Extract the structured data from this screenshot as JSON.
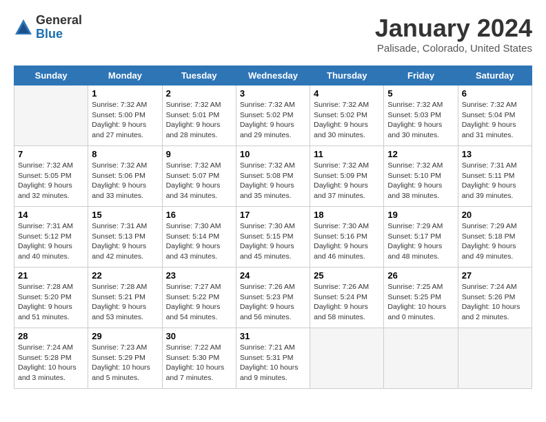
{
  "logo": {
    "general": "General",
    "blue": "Blue"
  },
  "header": {
    "title": "January 2024",
    "subtitle": "Palisade, Colorado, United States"
  },
  "days_of_week": [
    "Sunday",
    "Monday",
    "Tuesday",
    "Wednesday",
    "Thursday",
    "Friday",
    "Saturday"
  ],
  "weeks": [
    [
      {
        "day": "",
        "info": ""
      },
      {
        "day": "1",
        "info": "Sunrise: 7:32 AM\nSunset: 5:00 PM\nDaylight: 9 hours\nand 27 minutes."
      },
      {
        "day": "2",
        "info": "Sunrise: 7:32 AM\nSunset: 5:01 PM\nDaylight: 9 hours\nand 28 minutes."
      },
      {
        "day": "3",
        "info": "Sunrise: 7:32 AM\nSunset: 5:02 PM\nDaylight: 9 hours\nand 29 minutes."
      },
      {
        "day": "4",
        "info": "Sunrise: 7:32 AM\nSunset: 5:02 PM\nDaylight: 9 hours\nand 30 minutes."
      },
      {
        "day": "5",
        "info": "Sunrise: 7:32 AM\nSunset: 5:03 PM\nDaylight: 9 hours\nand 30 minutes."
      },
      {
        "day": "6",
        "info": "Sunrise: 7:32 AM\nSunset: 5:04 PM\nDaylight: 9 hours\nand 31 minutes."
      }
    ],
    [
      {
        "day": "7",
        "info": "Sunrise: 7:32 AM\nSunset: 5:05 PM\nDaylight: 9 hours\nand 32 minutes."
      },
      {
        "day": "8",
        "info": "Sunrise: 7:32 AM\nSunset: 5:06 PM\nDaylight: 9 hours\nand 33 minutes."
      },
      {
        "day": "9",
        "info": "Sunrise: 7:32 AM\nSunset: 5:07 PM\nDaylight: 9 hours\nand 34 minutes."
      },
      {
        "day": "10",
        "info": "Sunrise: 7:32 AM\nSunset: 5:08 PM\nDaylight: 9 hours\nand 35 minutes."
      },
      {
        "day": "11",
        "info": "Sunrise: 7:32 AM\nSunset: 5:09 PM\nDaylight: 9 hours\nand 37 minutes."
      },
      {
        "day": "12",
        "info": "Sunrise: 7:32 AM\nSunset: 5:10 PM\nDaylight: 9 hours\nand 38 minutes."
      },
      {
        "day": "13",
        "info": "Sunrise: 7:31 AM\nSunset: 5:11 PM\nDaylight: 9 hours\nand 39 minutes."
      }
    ],
    [
      {
        "day": "14",
        "info": "Sunrise: 7:31 AM\nSunset: 5:12 PM\nDaylight: 9 hours\nand 40 minutes."
      },
      {
        "day": "15",
        "info": "Sunrise: 7:31 AM\nSunset: 5:13 PM\nDaylight: 9 hours\nand 42 minutes."
      },
      {
        "day": "16",
        "info": "Sunrise: 7:30 AM\nSunset: 5:14 PM\nDaylight: 9 hours\nand 43 minutes."
      },
      {
        "day": "17",
        "info": "Sunrise: 7:30 AM\nSunset: 5:15 PM\nDaylight: 9 hours\nand 45 minutes."
      },
      {
        "day": "18",
        "info": "Sunrise: 7:30 AM\nSunset: 5:16 PM\nDaylight: 9 hours\nand 46 minutes."
      },
      {
        "day": "19",
        "info": "Sunrise: 7:29 AM\nSunset: 5:17 PM\nDaylight: 9 hours\nand 48 minutes."
      },
      {
        "day": "20",
        "info": "Sunrise: 7:29 AM\nSunset: 5:18 PM\nDaylight: 9 hours\nand 49 minutes."
      }
    ],
    [
      {
        "day": "21",
        "info": "Sunrise: 7:28 AM\nSunset: 5:20 PM\nDaylight: 9 hours\nand 51 minutes."
      },
      {
        "day": "22",
        "info": "Sunrise: 7:28 AM\nSunset: 5:21 PM\nDaylight: 9 hours\nand 53 minutes."
      },
      {
        "day": "23",
        "info": "Sunrise: 7:27 AM\nSunset: 5:22 PM\nDaylight: 9 hours\nand 54 minutes."
      },
      {
        "day": "24",
        "info": "Sunrise: 7:26 AM\nSunset: 5:23 PM\nDaylight: 9 hours\nand 56 minutes."
      },
      {
        "day": "25",
        "info": "Sunrise: 7:26 AM\nSunset: 5:24 PM\nDaylight: 9 hours\nand 58 minutes."
      },
      {
        "day": "26",
        "info": "Sunrise: 7:25 AM\nSunset: 5:25 PM\nDaylight: 10 hours\nand 0 minutes."
      },
      {
        "day": "27",
        "info": "Sunrise: 7:24 AM\nSunset: 5:26 PM\nDaylight: 10 hours\nand 2 minutes."
      }
    ],
    [
      {
        "day": "28",
        "info": "Sunrise: 7:24 AM\nSunset: 5:28 PM\nDaylight: 10 hours\nand 3 minutes."
      },
      {
        "day": "29",
        "info": "Sunrise: 7:23 AM\nSunset: 5:29 PM\nDaylight: 10 hours\nand 5 minutes."
      },
      {
        "day": "30",
        "info": "Sunrise: 7:22 AM\nSunset: 5:30 PM\nDaylight: 10 hours\nand 7 minutes."
      },
      {
        "day": "31",
        "info": "Sunrise: 7:21 AM\nSunset: 5:31 PM\nDaylight: 10 hours\nand 9 minutes."
      },
      {
        "day": "",
        "info": ""
      },
      {
        "day": "",
        "info": ""
      },
      {
        "day": "",
        "info": ""
      }
    ]
  ]
}
